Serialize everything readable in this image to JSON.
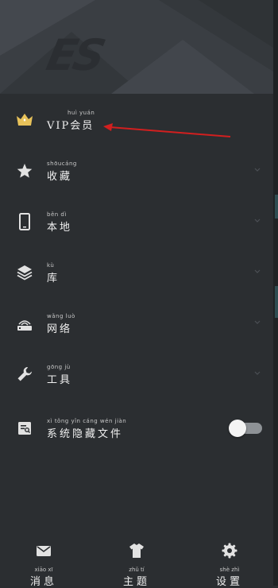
{
  "app": {
    "logo_text": "ES"
  },
  "menu": {
    "items": [
      {
        "pinyin": "huì yuán",
        "label": "VIP会员",
        "icon": "crown-icon"
      },
      {
        "pinyin": "shōucáng",
        "label": "收藏",
        "icon": "star-icon"
      },
      {
        "pinyin": "běn dì",
        "label": "本地",
        "icon": "phone-icon"
      },
      {
        "pinyin": "kù",
        "label": "库",
        "icon": "layers-icon"
      },
      {
        "pinyin": "wǎng luò",
        "label": "网络",
        "icon": "router-icon"
      },
      {
        "pinyin": "gōng jù",
        "label": "工具",
        "icon": "wrench-icon"
      },
      {
        "pinyin": "xì tǒng yǐn cáng wén jiàn",
        "label": "系统隐藏文件",
        "icon": "hidden-file-icon",
        "toggle_on": false
      }
    ]
  },
  "bottom_nav": {
    "tabs": [
      {
        "pinyin": "xiāo xī",
        "label": "消息",
        "icon": "mail-icon"
      },
      {
        "pinyin": "zhǔ tí",
        "label": "主题",
        "icon": "shirt-icon"
      },
      {
        "pinyin": "shè zhì",
        "label": "设置",
        "icon": "gear-icon"
      }
    ]
  },
  "colors": {
    "background": "#2b2e31",
    "header": "#3b3f44",
    "crown": "#e8c25a",
    "annotation_arrow": "#d21f1f"
  }
}
